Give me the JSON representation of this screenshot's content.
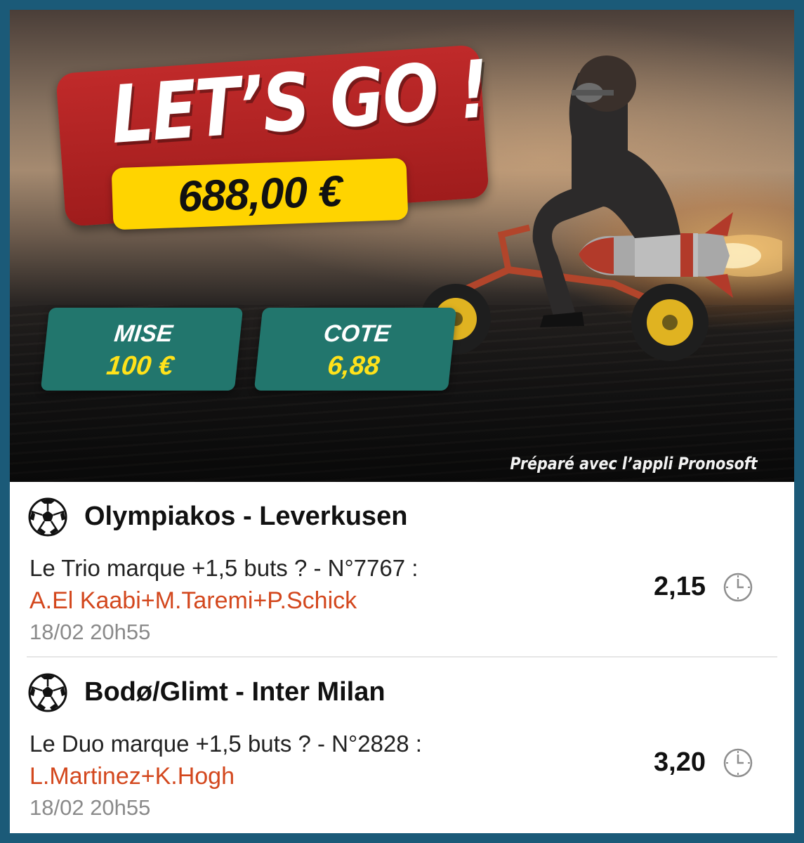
{
  "banner": {
    "title": "LET’S GO !",
    "amount": "688,00 €",
    "stake": {
      "label": "MISE",
      "value": "100 €"
    },
    "odds": {
      "label": "COTE",
      "value": "6,88"
    },
    "credit": "Préparé avec l’appli Pronosoft"
  },
  "bets": [
    {
      "match": "Olympiakos - Leverkusen",
      "question": "Le Trio marque +1,5 buts ? - N°7767 :",
      "players": "A.El Kaabi+M.Taremi+P.Schick",
      "datetime": "18/02 20h55",
      "odds": "2,15",
      "icon": "soccer-ball-icon",
      "status_icon": "clock-icon"
    },
    {
      "match": "Bodø/Glimt - Inter Milan",
      "question": "Le Duo marque +1,5 buts ? - N°2828 :",
      "players": "L.Martinez+K.Hogh",
      "datetime": "18/02 20h55",
      "odds": "3,20",
      "icon": "soccer-ball-icon",
      "status_icon": "clock-icon"
    }
  ],
  "colors": {
    "frame": "#1b5a78",
    "title_box": "#b22222",
    "amount_box": "#ffd400",
    "stat_box": "#22766d",
    "stat_value": "#ffe21a",
    "players_text": "#d3471d",
    "meta_text": "#8a8a8a"
  }
}
